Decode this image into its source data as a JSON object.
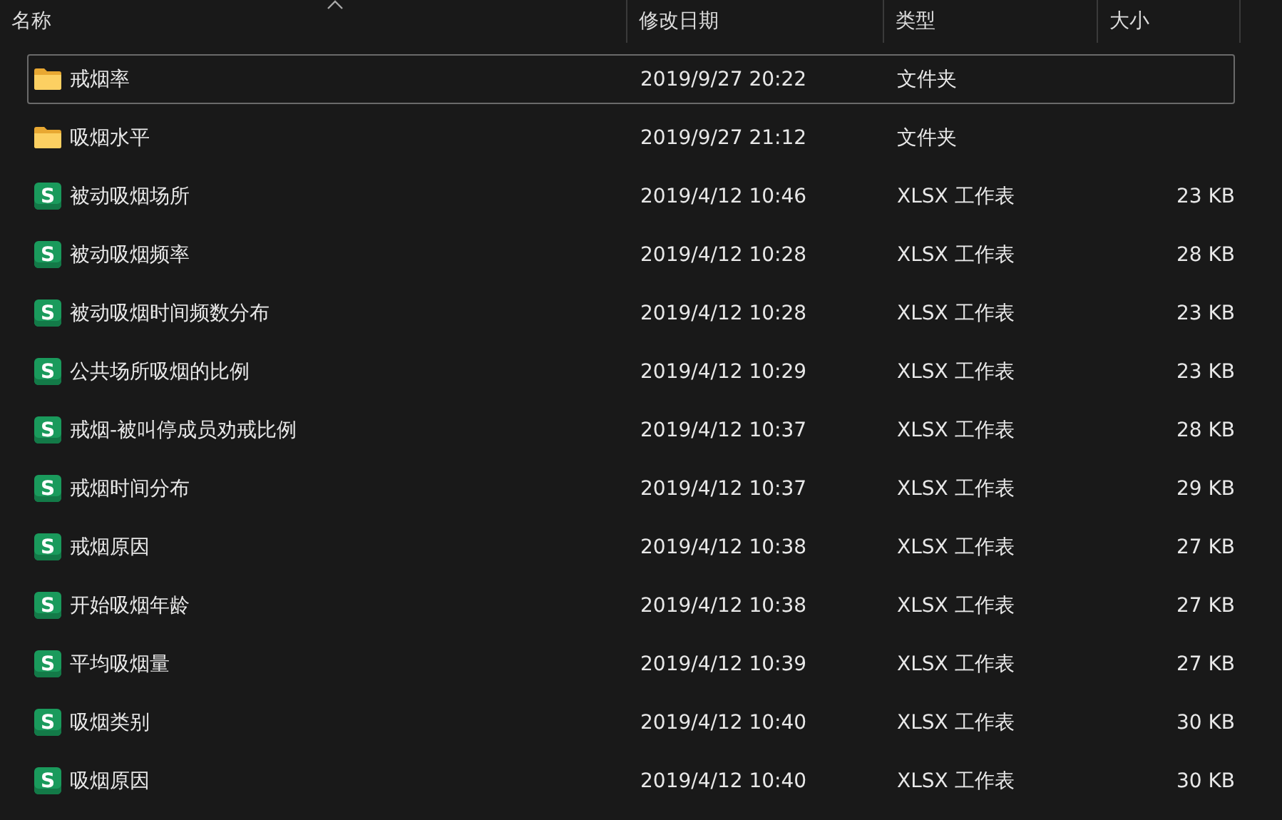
{
  "columns": [
    {
      "label": "名称",
      "sorted": true
    },
    {
      "label": "修改日期",
      "sorted": false
    },
    {
      "label": "类型",
      "sorted": false
    },
    {
      "label": "大小",
      "sorted": false
    }
  ],
  "files": [
    {
      "kind": "folder",
      "name": "戒烟率",
      "modified": "2019/9/27 20:22",
      "type": "文件夹",
      "focused": true
    },
    {
      "kind": "folder",
      "name": "吸烟水平",
      "modified": "2019/9/27 21:12",
      "type": "文件夹",
      "focused": false
    },
    {
      "kind": "sheet",
      "icon_text": "S",
      "name": "被动吸烟场所",
      "modified": "2019/4/12 10:46",
      "type": "XLSX 工作表",
      "size": "23 KB",
      "focused": false
    },
    {
      "kind": "sheet",
      "icon_text": "S",
      "name": "被动吸烟频率",
      "modified": "2019/4/12 10:28",
      "type": "XLSX 工作表",
      "size": "28 KB",
      "focused": false
    },
    {
      "kind": "sheet",
      "icon_text": "S",
      "name": "被动吸烟时间频数分布",
      "modified": "2019/4/12 10:28",
      "type": "XLSX 工作表",
      "size": "23 KB",
      "focused": false
    },
    {
      "kind": "sheet",
      "icon_text": "S",
      "name": "公共场所吸烟的比例",
      "modified": "2019/4/12 10:29",
      "type": "XLSX 工作表",
      "size": "23 KB",
      "focused": false
    },
    {
      "kind": "sheet",
      "icon_text": "S",
      "name": "戒烟-被叫停成员劝戒比例",
      "modified": "2019/4/12 10:37",
      "type": "XLSX 工作表",
      "size": "28 KB",
      "focused": false
    },
    {
      "kind": "sheet",
      "icon_text": "S",
      "name": "戒烟时间分布",
      "modified": "2019/4/12 10:37",
      "type": "XLSX 工作表",
      "size": "29 KB",
      "focused": false
    },
    {
      "kind": "sheet",
      "icon_text": "S",
      "name": "戒烟原因",
      "modified": "2019/4/12 10:38",
      "type": "XLSX 工作表",
      "size": "27 KB",
      "focused": false
    },
    {
      "kind": "sheet",
      "icon_text": "S",
      "name": "开始吸烟年龄",
      "modified": "2019/4/12 10:38",
      "type": "XLSX 工作表",
      "size": "27 KB",
      "focused": false
    },
    {
      "kind": "sheet",
      "icon_text": "S",
      "name": "平均吸烟量",
      "modified": "2019/4/12 10:39",
      "type": "XLSX 工作表",
      "size": "27 KB",
      "focused": false
    },
    {
      "kind": "sheet",
      "icon_text": "S",
      "name": "吸烟类别",
      "modified": "2019/4/12 10:40",
      "type": "XLSX 工作表",
      "size": "30 KB",
      "focused": false
    },
    {
      "kind": "sheet",
      "icon_text": "S",
      "name": "吸烟原因",
      "modified": "2019/4/12 10:40",
      "type": "XLSX 工作表",
      "size": "30 KB",
      "focused": false
    }
  ]
}
